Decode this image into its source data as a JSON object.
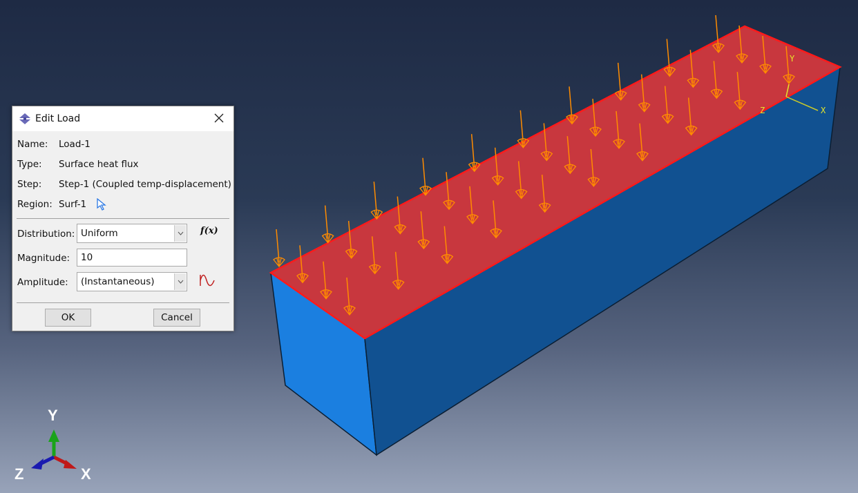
{
  "dialog": {
    "title": "Edit Load",
    "name_label": "Name:",
    "name_value": "Load-1",
    "type_label": "Type:",
    "type_value": "Surface heat flux",
    "step_label": "Step:",
    "step_value": "Step-1 (Coupled temp-displacement)",
    "region_label": "Region:",
    "region_value": "Surf-1",
    "distribution_label": "Distribution:",
    "distribution_value": "Uniform",
    "fx_label": "f(x)",
    "magnitude_label": "Magnitude:",
    "magnitude_value": "10",
    "amplitude_label": "Amplitude:",
    "amplitude_value": "(Instantaneous)",
    "ok_label": "OK",
    "cancel_label": "Cancel"
  },
  "viewport": {
    "colors": {
      "loaded_surface": "#c8373e",
      "surface_edge": "#ff1a1a",
      "front_face": "#1b7fe0",
      "side_face": "#115191",
      "load_arrow": "#ff8c00",
      "csys": "#e6e62a"
    },
    "local_csys_labels": {
      "x": "X",
      "y": "Y",
      "z": "Z"
    },
    "triad_labels": {
      "x": "X",
      "y": "Y",
      "z": "Z"
    }
  }
}
